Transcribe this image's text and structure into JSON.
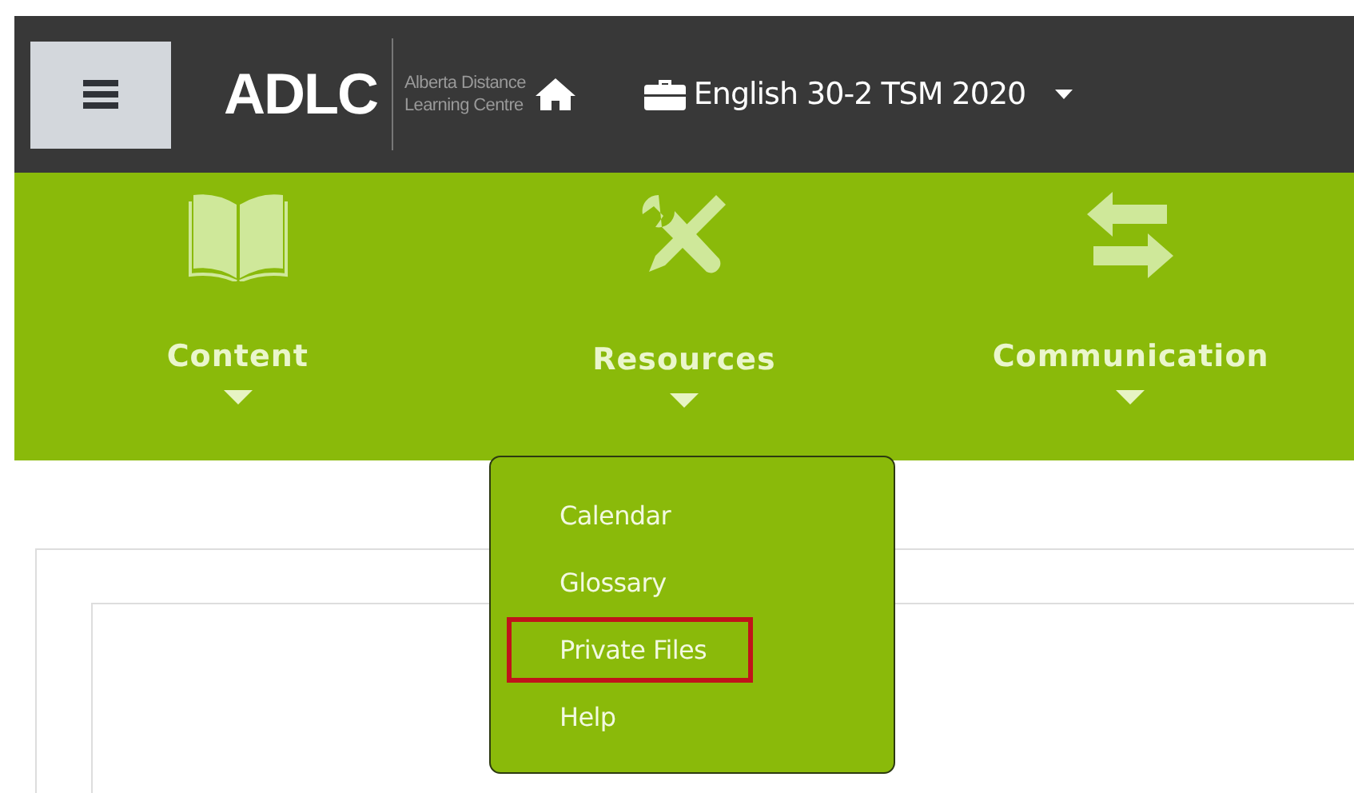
{
  "header": {
    "logo": "ADLC",
    "logo_subtitle": [
      "Alberta Distance",
      "Learning Centre"
    ],
    "course_title": "English 30-2 TSM 2020"
  },
  "nav": [
    {
      "label": "Content"
    },
    {
      "label": "Resources",
      "menu": [
        {
          "label": "Calendar",
          "highlighted": false
        },
        {
          "label": "Glossary",
          "highlighted": false
        },
        {
          "label": "Private Files",
          "highlighted": true
        },
        {
          "label": "Help",
          "highlighted": false
        }
      ]
    },
    {
      "label": "Communication"
    }
  ]
}
